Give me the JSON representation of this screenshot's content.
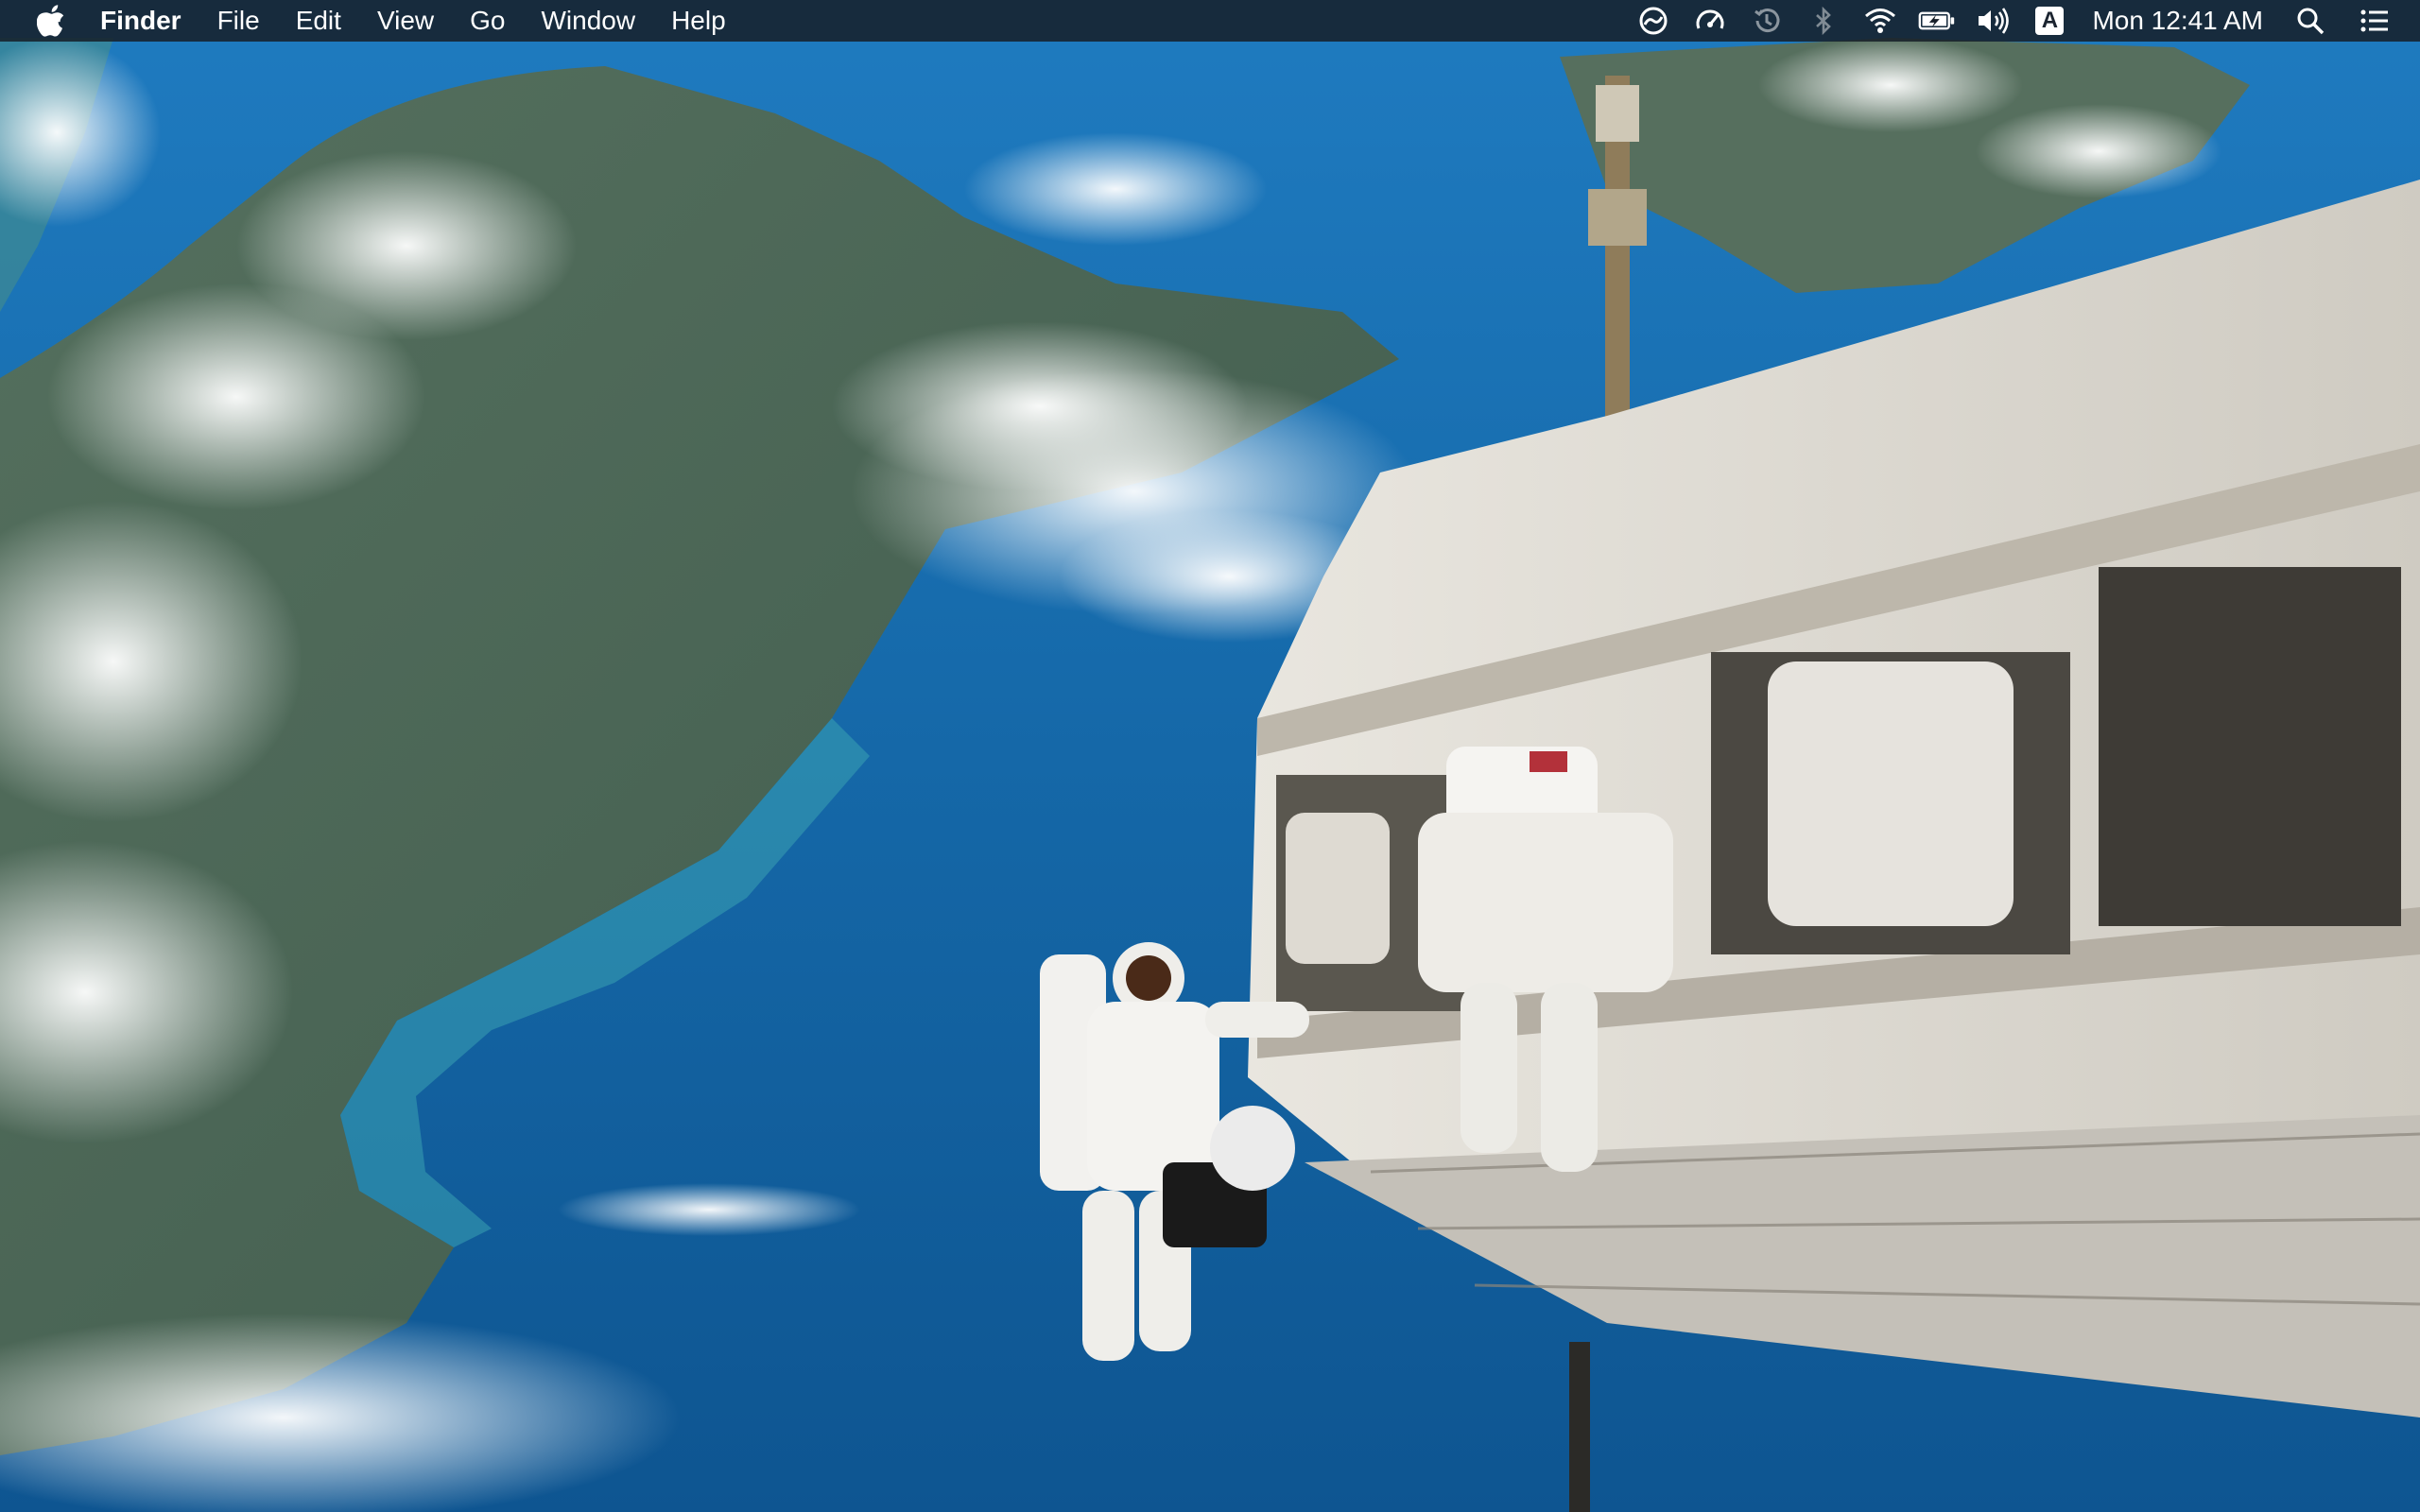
{
  "menubar": {
    "apple_icon": "apple-logo-icon",
    "app_name": "Finder",
    "menus": [
      "File",
      "Edit",
      "View",
      "Go",
      "Window",
      "Help"
    ],
    "status_icons": [
      "creative-cloud-icon",
      "dashboard-speed-icon",
      "time-machine-icon",
      "bluetooth-icon",
      "wifi-icon",
      "battery-charging-icon",
      "volume-icon"
    ],
    "input_source": "A",
    "clock": "Mon 12:41 AM",
    "right_icons": [
      "spotlight-search-icon",
      "notification-center-icon"
    ]
  },
  "colors": {
    "menubar_bg": "#161e28",
    "ocean": "#1a6fb0",
    "land": "#4d6a5a"
  }
}
